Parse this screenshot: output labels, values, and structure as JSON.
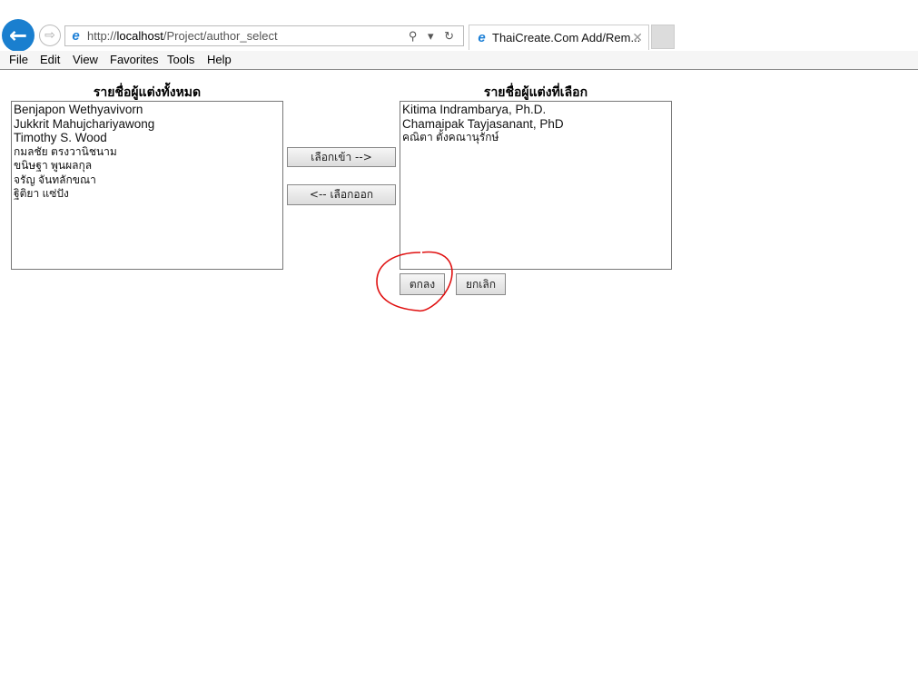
{
  "browser": {
    "url_prefix": "http://",
    "url_host": "localhost",
    "url_path": "/Project/author_select",
    "address_icons": "⚲ ▾ ↻",
    "tab_title": "ThaiCreate.Com Add/Rem...",
    "tab_close": "✕",
    "back_glyph": "←",
    "forward_glyph": "⇨",
    "menu": [
      "File",
      "Edit",
      "View",
      "Favorites",
      "Tools",
      "Help"
    ]
  },
  "page": {
    "all_authors_title": "รายชื่อผู้แต่งทั้งหมด",
    "selected_authors_title": "รายชื่อผู้แต่งที่เลือก",
    "all_authors": [
      "Benjapon Wethyavivorn",
      "Jukkrit Mahujchariyawong",
      "Timothy S. Wood",
      "กมลชัย ตรงวานิชนาม",
      "ขนิษฐา พูนผลกุล",
      "จรัญ จันทลักขณา",
      "ฐิติยา แซ่ปัง"
    ],
    "selected_authors": [
      "Kitima Indrambarya, Ph.D.",
      "Chamaipak Tayjasanant, PhD",
      "คณิตา ตั้งคณานุรักษ์"
    ],
    "add_button": "เลือกเข้า -->",
    "remove_button": "<-- เลือกออก",
    "ok_button": "ตกลง",
    "cancel_button": "ยกเลิก"
  },
  "annotation_color": "#e01010",
  "accent_color": "#1a7fcf"
}
